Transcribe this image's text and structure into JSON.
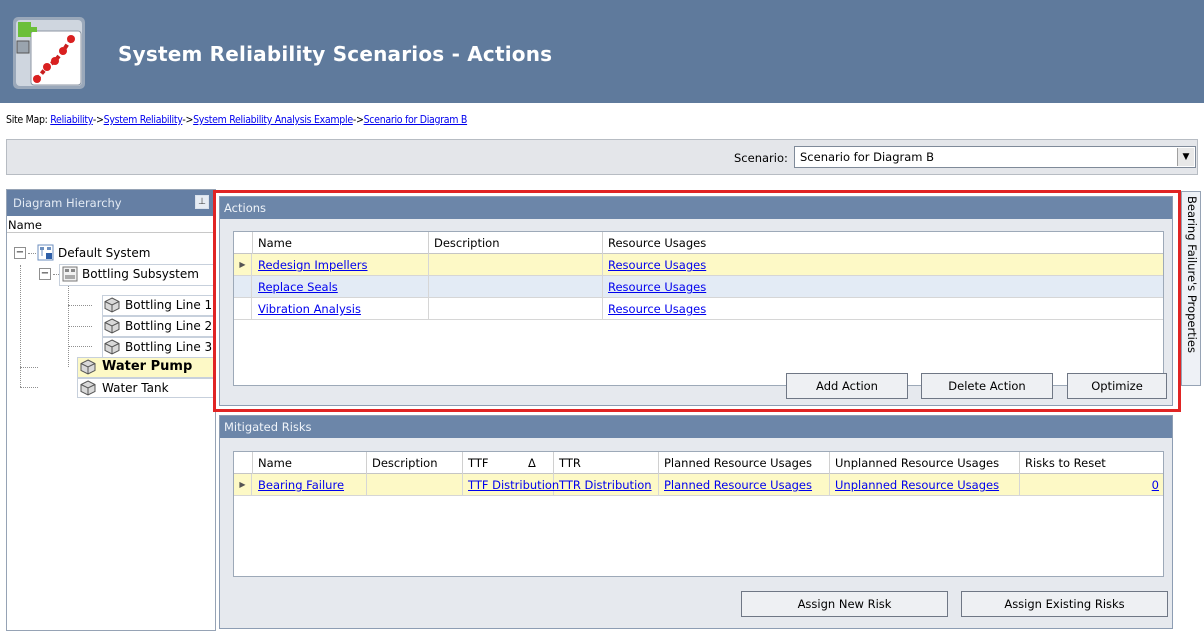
{
  "header": {
    "title": "System Reliability Scenarios  - Actions",
    "icon": "reliability-diagram-icon"
  },
  "sitemap": {
    "prefix": "Site Map:",
    "separator": "->",
    "crumbs": [
      "Reliability",
      "System Reliability",
      "System Reliability Analysis Example",
      "Scenario for Diagram B"
    ]
  },
  "scenario": {
    "label": "Scenario:",
    "value": "Scenario for Diagram B"
  },
  "hierarchy": {
    "title": "Diagram Hierarchy",
    "column": "Name",
    "nodes": [
      {
        "label": "Default System",
        "icon": "system-icon"
      },
      {
        "label": "Bottling Subsystem",
        "icon": "subsystem-icon"
      },
      {
        "label": "Bottling Line 1",
        "icon": "asset-cube-icon"
      },
      {
        "label": "Bottling Line 2",
        "icon": "asset-cube-icon"
      },
      {
        "label": "Bottling Line 3",
        "icon": "asset-cube-icon"
      },
      {
        "label": "Water Pump",
        "icon": "asset-cube-icon"
      },
      {
        "label": "Water Tank",
        "icon": "asset-cube-icon"
      }
    ]
  },
  "side_tab": {
    "label": "Bearing Failure's Properties"
  },
  "actions": {
    "title": "Actions",
    "columns": [
      "Name",
      "Description",
      "Resource Usages"
    ],
    "rows": [
      {
        "name": "Redesign Impellers",
        "description": "",
        "usages": "Resource Usages"
      },
      {
        "name": "Replace Seals",
        "description": "",
        "usages": "Resource Usages"
      },
      {
        "name": "Vibration Analysis",
        "description": "",
        "usages": "Resource Usages"
      }
    ],
    "buttons": {
      "add": "Add Action",
      "delete": "Delete Action",
      "optimize": "Optimize"
    }
  },
  "risks": {
    "title": "Mitigated Risks",
    "columns": [
      "Name",
      "Description",
      "TTF",
      "TTR",
      "Planned Resource Usages",
      "Unplanned Resource Usages",
      "Risks to Reset"
    ],
    "sort_glyph": "Δ",
    "rows": [
      {
        "name": "Bearing Failure",
        "description": "",
        "ttf": "TTF Distribution",
        "ttr": "TTR Distribution",
        "planned": "Planned Resource Usages",
        "unplanned": "Unplanned Resource Usages",
        "reset": "0"
      }
    ],
    "buttons": {
      "assign_new": "Assign New Risk",
      "assign_existing": "Assign Existing Risks"
    }
  },
  "colors": {
    "header_bg": "#5f7a9c",
    "panel_head": "#6c86a9",
    "selection": "#fdf9c6",
    "highlight_frame": "#e02424",
    "link": "#0000ee"
  }
}
